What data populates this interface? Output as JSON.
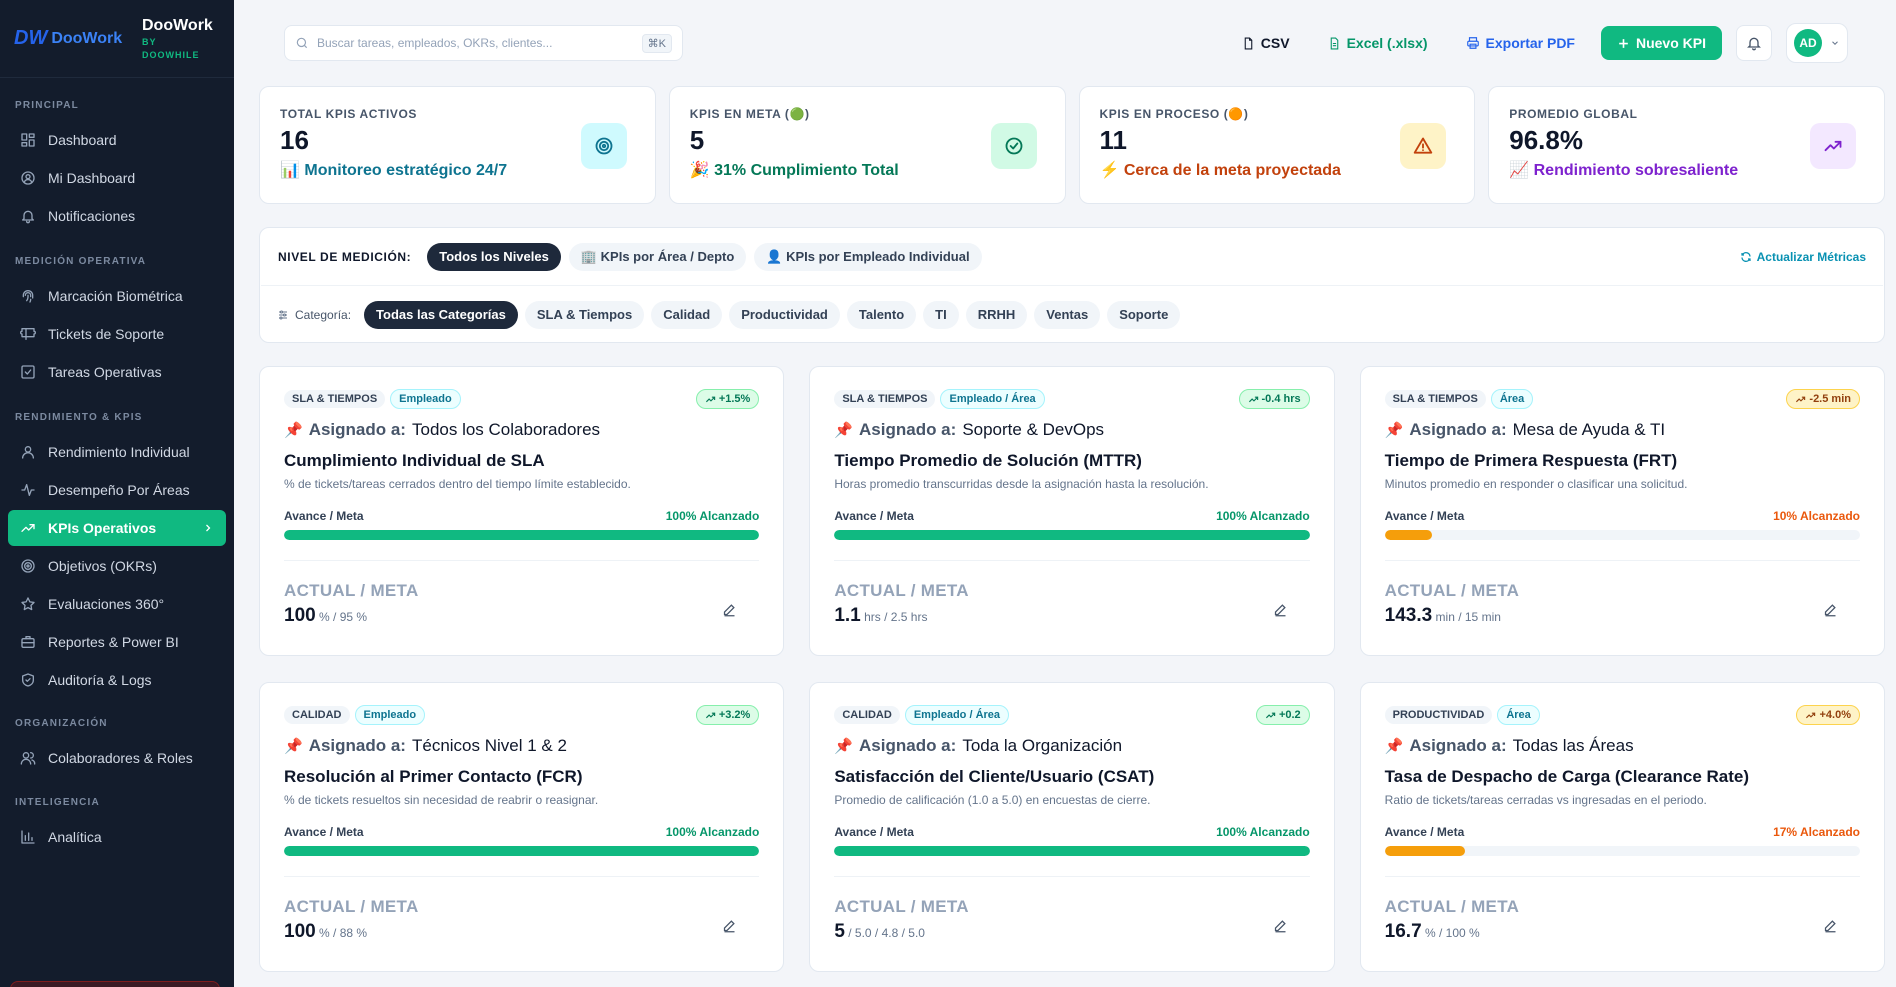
{
  "brand": {
    "logo_mark": "DW",
    "logo_word": "DooWork",
    "name": "DooWork",
    "by_line1": "BY",
    "by_line2": "DOOWHILE"
  },
  "sidebar": {
    "sections": [
      {
        "title": "PRINCIPAL",
        "items": [
          {
            "label": "Dashboard",
            "icon": "dashboard-icon"
          },
          {
            "label": "Mi Dashboard",
            "icon": "user-circle-icon"
          },
          {
            "label": "Notificaciones",
            "icon": "bell-icon"
          }
        ]
      },
      {
        "title": "MEDICIÓN OPERATIVA",
        "items": [
          {
            "label": "Marcación Biométrica",
            "icon": "fingerprint-icon"
          },
          {
            "label": "Tickets de Soporte",
            "icon": "ticket-icon"
          },
          {
            "label": "Tareas Operativas",
            "icon": "checkbox-icon"
          }
        ]
      },
      {
        "title": "RENDIMIENTO & KPIS",
        "items": [
          {
            "label": "Rendimiento Individual",
            "icon": "user-icon"
          },
          {
            "label": "Desempeño Por Áreas",
            "icon": "activity-icon"
          },
          {
            "label": "KPIs Operativos",
            "icon": "trending-up-icon",
            "active": true
          },
          {
            "label": "Objetivos (OKRs)",
            "icon": "target-icon"
          },
          {
            "label": "Evaluaciones 360°",
            "icon": "star-icon"
          },
          {
            "label": "Reportes & Power BI",
            "icon": "briefcase-icon"
          },
          {
            "label": "Auditoría & Logs",
            "icon": "shield-icon"
          }
        ]
      },
      {
        "title": "ORGANIZACIÓN",
        "items": [
          {
            "label": "Colaboradores & Roles",
            "icon": "users-icon"
          }
        ]
      },
      {
        "title": "INTELIGENCIA",
        "items": [
          {
            "label": "Analítica",
            "icon": "bar-chart-icon"
          }
        ]
      }
    ]
  },
  "topbar": {
    "search_placeholder": "Buscar tareas, empleados, OKRs, clientes...",
    "search_shortcut": "⌘K",
    "csv": "CSV",
    "excel": "Excel (.xlsx)",
    "pdf": "Exportar PDF",
    "new_kpi": "Nuevo KPI",
    "user_initials": "AD"
  },
  "stats": [
    {
      "label": "TOTAL KPIS ACTIVOS",
      "value": "16",
      "sub": "📊 Monitoreo estratégico 24/7",
      "sub_color": "#0e7490",
      "icon": "target-icon",
      "icon_bg": "#cffafe",
      "icon_color": "#0e7490"
    },
    {
      "label": "KPIS EN META (🟢)",
      "value": "5",
      "sub": "🎉 31% Cumplimiento Total",
      "sub_color": "#047857",
      "icon": "check-circle-icon",
      "icon_bg": "#d1fae5",
      "icon_color": "#047857"
    },
    {
      "label": "KPIS EN PROCESO (🟠)",
      "value": "11",
      "sub": "⚡ Cerca de la meta proyectada",
      "sub_color": "#c2410c",
      "icon": "alert-triangle-icon",
      "icon_bg": "#fef3c7",
      "icon_color": "#c2410c"
    },
    {
      "label": "PROMEDIO GLOBAL",
      "value": "96.8%",
      "sub": "📈 Rendimiento sobresaliente",
      "sub_color": "#7e22ce",
      "icon": "trending-up-icon",
      "icon_bg": "#f3e8ff",
      "icon_color": "#7e22ce"
    }
  ],
  "filters": {
    "level_label": "NIVEL DE MEDICIÓN:",
    "levels": [
      {
        "label": "Todos los Niveles",
        "selected": true
      },
      {
        "label": "🏢 KPIs por Área / Depto"
      },
      {
        "label": "👤 KPIs por Empleado Individual"
      }
    ],
    "refresh": "Actualizar Métricas",
    "category_label": "Categoría:",
    "categories": [
      {
        "label": "Todas las Categorías",
        "selected": true
      },
      {
        "label": "SLA & Tiempos"
      },
      {
        "label": "Calidad"
      },
      {
        "label": "Productividad"
      },
      {
        "label": "Talento"
      },
      {
        "label": "TI"
      },
      {
        "label": "RRHH"
      },
      {
        "label": "Ventas"
      },
      {
        "label": "Soporte"
      }
    ]
  },
  "kpis": [
    {
      "category": "SLA & TIEMPOS",
      "scope": "Empleado",
      "trend": "+1.5%",
      "trend_type": "up",
      "assigned_label": "Asignado a:",
      "assigned": "Todos los Colaboradores",
      "title": "Cumplimiento Individual de SLA",
      "desc": "% de tickets/tareas cerrados dentro del tiempo límite establecido.",
      "progress_label": "Avance / Meta",
      "achieved": "100% Alcanzado",
      "progress": 100,
      "status": "ok",
      "am_label": "ACTUAL / META",
      "actual": "100",
      "unit_meta": "% / 95 %"
    },
    {
      "category": "SLA & TIEMPOS",
      "scope": "Empleado / Área",
      "trend": "-0.4 hrs",
      "trend_type": "up",
      "assigned_label": "Asignado a:",
      "assigned": "Soporte & DevOps",
      "title": "Tiempo Promedio de Solución (MTTR)",
      "desc": "Horas promedio transcurridas desde la asignación hasta la resolución.",
      "progress_label": "Avance / Meta",
      "achieved": "100% Alcanzado",
      "progress": 100,
      "status": "ok",
      "am_label": "ACTUAL / META",
      "actual": "1.1",
      "unit_meta": "hrs / 2.5 hrs"
    },
    {
      "category": "SLA & TIEMPOS",
      "scope": "Área",
      "trend": "-2.5 min",
      "trend_type": "warn",
      "assigned_label": "Asignado a:",
      "assigned": "Mesa de Ayuda & TI",
      "title": "Tiempo de Primera Respuesta (FRT)",
      "desc": "Minutos promedio en responder o clasificar una solicitud.",
      "progress_label": "Avance / Meta",
      "achieved": "10% Alcanzado",
      "progress": 10,
      "status": "low",
      "am_label": "ACTUAL / META",
      "actual": "143.3",
      "unit_meta": "min / 15 min"
    },
    {
      "category": "CALIDAD",
      "scope": "Empleado",
      "trend": "+3.2%",
      "trend_type": "up",
      "assigned_label": "Asignado a:",
      "assigned": "Técnicos Nivel 1 & 2",
      "title": "Resolución al Primer Contacto (FCR)",
      "desc": "% de tickets resueltos sin necesidad de reabrir o reasignar.",
      "progress_label": "Avance / Meta",
      "achieved": "100% Alcanzado",
      "progress": 100,
      "status": "ok",
      "am_label": "ACTUAL / META",
      "actual": "100",
      "unit_meta": "% / 88 %"
    },
    {
      "category": "CALIDAD",
      "scope": "Empleado / Área",
      "trend": "+0.2",
      "trend_type": "up",
      "assigned_label": "Asignado a:",
      "assigned": "Toda la Organización",
      "title": "Satisfacción del Cliente/Usuario (CSAT)",
      "desc": "Promedio de calificación (1.0 a 5.0) en encuestas de cierre.",
      "progress_label": "Avance / Meta",
      "achieved": "100% Alcanzado",
      "progress": 100,
      "status": "ok",
      "am_label": "ACTUAL / META",
      "actual": "5",
      "unit_meta": "/ 5.0 / 4.8 / 5.0"
    },
    {
      "category": "PRODUCTIVIDAD",
      "scope": "Área",
      "trend": "+4.0%",
      "trend_type": "warn",
      "assigned_label": "Asignado a:",
      "assigned": "Todas las Áreas",
      "title": "Tasa de Despacho de Carga (Clearance Rate)",
      "desc": "Ratio de tickets/tareas cerradas vs ingresadas en el periodo.",
      "progress_label": "Avance / Meta",
      "achieved": "17% Alcanzado",
      "progress": 17,
      "status": "low",
      "am_label": "ACTUAL / META",
      "actual": "16.7",
      "unit_meta": "% / 100 %"
    }
  ]
}
